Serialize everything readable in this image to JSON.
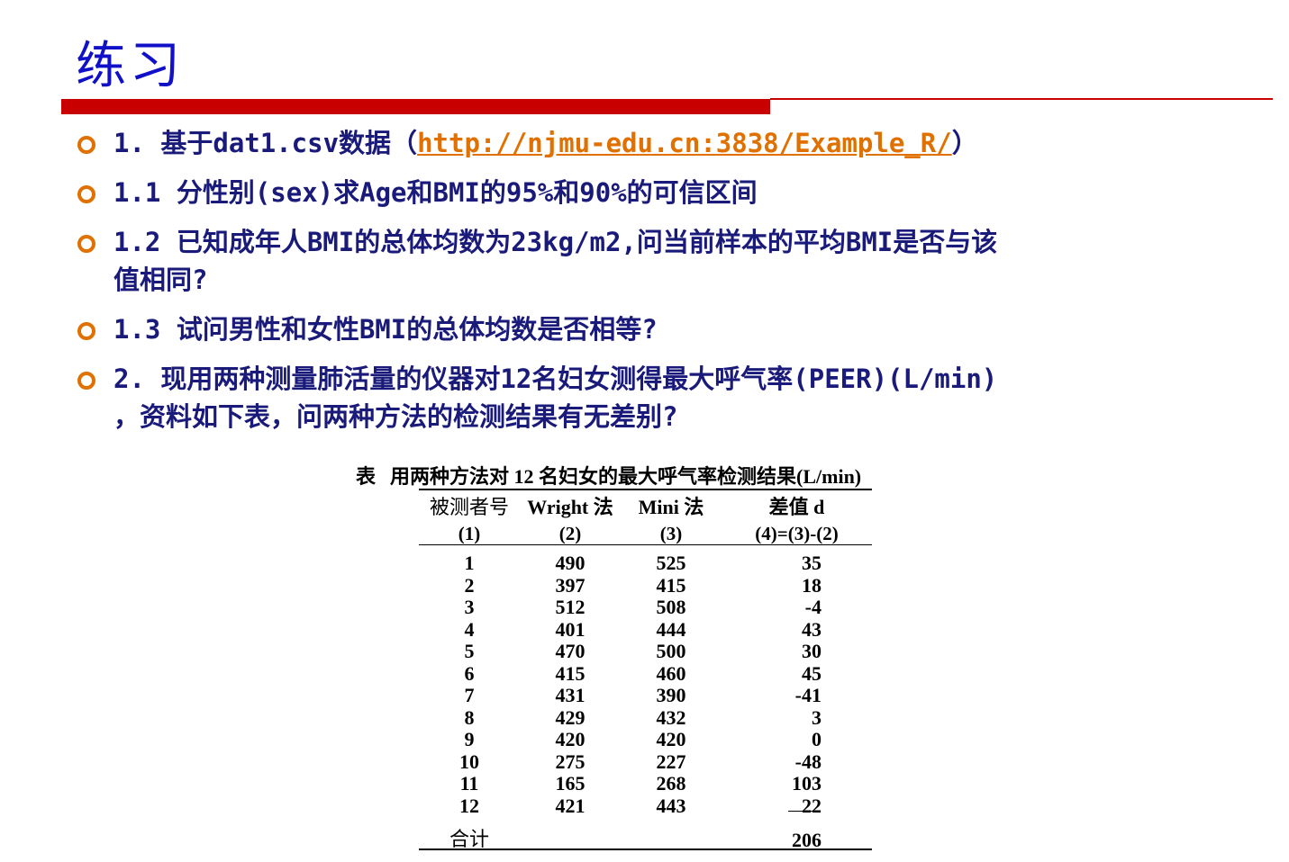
{
  "title": "练习",
  "bullets": [
    {
      "pre": "1. 基于dat1.csv数据（",
      "link": "http://njmu-edu.cn:3838/Example_R/",
      "post": "）",
      "cont": ""
    },
    {
      "pre": "1.1 分性别(sex)求Age和BMI的95%和90%的可信区间",
      "link": "",
      "post": "",
      "cont": ""
    },
    {
      "pre": "1.2 已知成年人BMI的总体均数为23kg/m2,问当前样本的平均BMI是否与该",
      "link": "",
      "post": "",
      "cont": "值相同?"
    },
    {
      "pre": "1.3 试问男性和女性BMI的总体均数是否相等?",
      "link": "",
      "post": "",
      "cont": ""
    },
    {
      "pre": "2. 现用两种测量肺活量的仪器对12名妇女测得最大呼气率(PEER)(L/min)",
      "link": "",
      "post": "",
      "cont": "，资料如下表，问两种方法的检测结果有无差别?"
    }
  ],
  "table": {
    "caption_tag": "表",
    "caption": "用两种方法对 12 名妇女的最大呼气率检测结果(L/min)",
    "headers": [
      "被测者号",
      "Wright 法",
      "Mini 法",
      "差值 d"
    ],
    "subheaders": [
      "(1)",
      "(2)",
      "(3)",
      "(4)=(3)-(2)"
    ],
    "rows": [
      [
        "1",
        "490",
        "525",
        "35"
      ],
      [
        "2",
        "397",
        "415",
        "18"
      ],
      [
        "3",
        "512",
        "508",
        "-4"
      ],
      [
        "4",
        "401",
        "444",
        "43"
      ],
      [
        "5",
        "470",
        "500",
        "30"
      ],
      [
        "6",
        "415",
        "460",
        "45"
      ],
      [
        "7",
        "431",
        "390",
        "-41"
      ],
      [
        "8",
        "429",
        "432",
        "3"
      ],
      [
        "9",
        "420",
        "420",
        "0"
      ],
      [
        "10",
        "275",
        "227",
        "-48"
      ],
      [
        "11",
        "165",
        "268",
        "103"
      ],
      [
        "12",
        "421",
        "443",
        "22"
      ]
    ],
    "total_label": "合计",
    "total_value": "206"
  },
  "colors": {
    "title": "#1010c8",
    "rule": "#c80000",
    "bullet_text": "#1a1a7a",
    "bullet_marker": "#e07000",
    "link": "#e07000"
  }
}
